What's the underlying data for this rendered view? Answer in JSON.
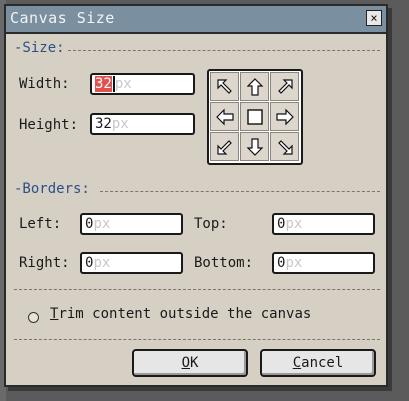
{
  "dialog": {
    "title": "Canvas Size",
    "close_glyph": "×"
  },
  "size_section": {
    "title": "-Size:"
  },
  "width": {
    "label": "Width:",
    "value": "32",
    "unit": "px"
  },
  "height": {
    "label": "Height:",
    "value": "32",
    "unit": "px"
  },
  "anchor": {
    "icons": [
      "arrow-up-left-icon",
      "arrow-up-icon",
      "arrow-up-right-icon",
      "arrow-left-icon",
      "center-square-icon",
      "arrow-right-icon",
      "arrow-down-left-icon",
      "arrow-down-icon",
      "arrow-down-right-icon"
    ]
  },
  "borders_section": {
    "title": "-Borders:"
  },
  "left": {
    "label": "Left:",
    "value": "0",
    "unit": "px"
  },
  "top": {
    "label": "Top:",
    "value": "0",
    "unit": "px"
  },
  "right": {
    "label": "Right:",
    "value": "0",
    "unit": "px"
  },
  "bottom": {
    "label": "Bottom:",
    "value": "0",
    "unit": "px"
  },
  "trim": {
    "label_first": "T",
    "label_rest": "rim content outside the canvas",
    "checked": false
  },
  "buttons": {
    "ok_first": "O",
    "ok_rest": "K",
    "cancel_first": "C",
    "cancel_rest": "ancel"
  }
}
